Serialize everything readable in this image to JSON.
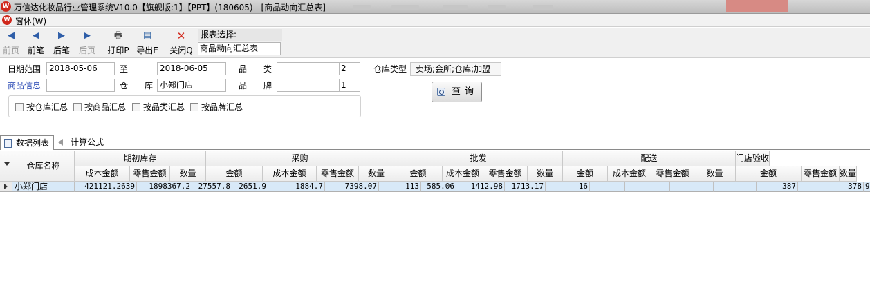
{
  "window": {
    "title": "万信达化妆品行业管理系统V10.0【旗舰版:1】【PPT】(180605) - [商品动向汇总表]"
  },
  "menu": {
    "window_label": "窗体(W)"
  },
  "toolbar": {
    "buttons": [
      {
        "label": "前页",
        "icon": "first-page-icon",
        "enabled": false
      },
      {
        "label": "前笔",
        "icon": "prev-record-icon",
        "enabled": true
      },
      {
        "label": "后笔",
        "icon": "next-record-icon",
        "enabled": true
      },
      {
        "label": "后页",
        "icon": "last-page-icon",
        "enabled": false
      },
      {
        "label": "打印P",
        "icon": "printer-icon",
        "enabled": true
      },
      {
        "label": "导出E",
        "icon": "export-icon",
        "enabled": true
      },
      {
        "label": "关闭Q",
        "icon": "close-icon",
        "enabled": true
      }
    ],
    "report_select_label": "报表选择:",
    "report_select_value": "商品动向汇总表"
  },
  "filters": {
    "date_range_label": "日期范围",
    "date_from": "2018-05-06",
    "to_label": "至",
    "date_to": "2018-06-05",
    "category_label": "品　　类",
    "category_value": "",
    "category_level": "2",
    "product_info_label": "商品信息",
    "product_info_value": "",
    "warehouse_label": "仓　　库",
    "warehouse_value": "小郑门店",
    "brand_label": "品　　牌",
    "brand_value": "",
    "brand_level": "1",
    "warehouse_type_label": "仓库类型",
    "warehouse_type_value": "卖场;会所;仓库;加盟",
    "checkboxes": [
      {
        "label": "按仓库汇总",
        "checked": false
      },
      {
        "label": "按商品汇总",
        "checked": false
      },
      {
        "label": "按品类汇总",
        "checked": false
      },
      {
        "label": "按品牌汇总",
        "checked": false
      }
    ],
    "query_button": "查询"
  },
  "tabs": [
    {
      "label": "数据列表",
      "active": true
    },
    {
      "label": "计算公式",
      "active": false
    }
  ],
  "grid": {
    "name_column": "仓库名称",
    "groups": [
      {
        "label": "期初库存",
        "columns": [
          "成本金额",
          "零售金额",
          "数量"
        ]
      },
      {
        "label": "采购",
        "columns": [
          "金额",
          "成本金额",
          "零售金额",
          "数量"
        ]
      },
      {
        "label": "批发",
        "columns": [
          "金额",
          "成本金额",
          "零售金额",
          "数量"
        ]
      },
      {
        "label": "配送",
        "columns": [
          "金额",
          "成本金额",
          "零售金额",
          "数量"
        ]
      },
      {
        "label": "门店验收",
        "columns": [
          "金额",
          "零售金额",
          "数量"
        ]
      }
    ],
    "rows": [
      {
        "name": "小郑门店",
        "cells": [
          "421121.2639",
          "1898367.2",
          "27557.8",
          "2651.9",
          "1884.7",
          "7398.07",
          "113",
          "585.06",
          "1412.98",
          "1713.17",
          "16",
          "",
          "",
          "",
          "",
          "387",
          "378",
          "9"
        ]
      }
    ]
  }
}
